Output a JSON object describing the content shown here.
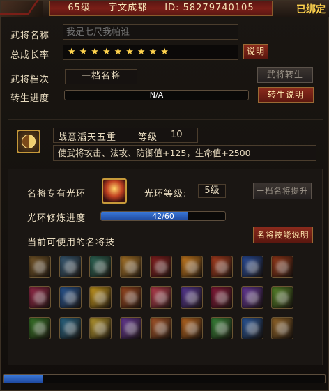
{
  "header": {
    "level": "65级",
    "name": "宇文成都",
    "id_label": "ID: 58279740105",
    "bound": "已绑定"
  },
  "rows": {
    "name_label": "武将名称",
    "name_placeholder": "我是七尺我帕谁",
    "growth_label": "总成长率",
    "growth_stars": "★★★★★★★★★",
    "explain_btn": "说明",
    "grade_label": "武将档次",
    "grade_value": "一档名将",
    "rebirth_btn": "武将转生",
    "progress_label": "转生进度",
    "progress_value": "N/A",
    "rebirth_explain_btn": "转生说明"
  },
  "buff": {
    "icon": "yin-yang-icon",
    "name": "战意滔天五重",
    "level_label": "等级",
    "level_value": "10",
    "description": "使武将攻击、法攻、防御值+125，生命值+2500"
  },
  "aura": {
    "label": "名将专有光环",
    "level_label": "光环等级:",
    "level_value": "5级",
    "upgrade_btn": "一档名将提升",
    "refine_label": "光环修炼进度",
    "refine_text": "42/60",
    "refine_current": 42,
    "refine_max": 60
  },
  "skills": {
    "label": "当前可使用的名将技",
    "explain_btn": "名将技能说明",
    "colors": [
      [
        "#7a5a2a",
        "#3b5f7a",
        "#2f6b5a",
        "#b07a2a",
        "#8a2020",
        "#d08020",
        "#b04020",
        "#2a4fa0",
        "#9a3a1a"
      ],
      [
        "#9a2a4a",
        "#2a5a9a",
        "#d0a020",
        "#a04a20",
        "#c04050",
        "#5a3a9a",
        "#8a1a3a",
        "#6a3aa0",
        "#5a8a2a"
      ],
      [
        "#3a7a2a",
        "#2a6a8a",
        "#c0a030",
        "#6a3a9a",
        "#b05a2a",
        "#c06a20",
        "#3a8a3a",
        "#2a5aa0",
        "#9a6a2a"
      ]
    ]
  },
  "bottom": {
    "progress": 0.12
  }
}
